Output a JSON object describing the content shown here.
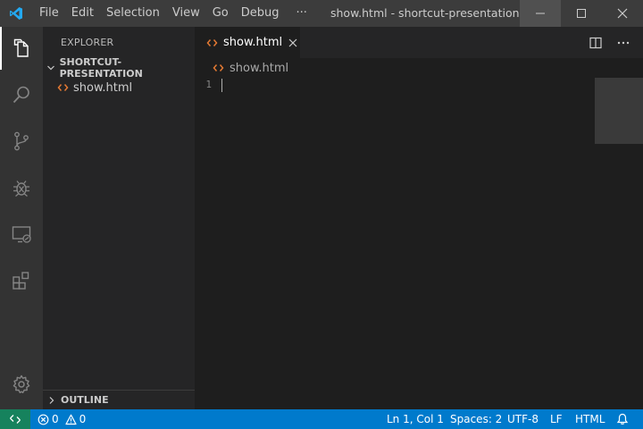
{
  "colors": {
    "accent": "#007acc",
    "remote": "#16825d",
    "logo": "#23a9f2",
    "html_icon": "#e37933",
    "titlebar": "#3c3c3c",
    "activitybar": "#333333",
    "sidebar": "#252526",
    "editor": "#1e1e1e"
  },
  "titlebar": {
    "logo_icon": "vscode-logo",
    "menu": [
      "File",
      "Edit",
      "Selection",
      "View",
      "Go",
      "Debug",
      "···"
    ],
    "title": "show.html - shortcut-presentation [Ad...",
    "buttons": [
      "minimize-icon",
      "maximize-icon",
      "close-icon"
    ]
  },
  "activitybar": {
    "items": [
      "explorer-icon",
      "search-icon",
      "source-control-icon",
      "debug-icon",
      "remote-explorer-icon",
      "extensions-icon"
    ],
    "active": "explorer-icon",
    "manage_icon": "gear-icon"
  },
  "sidebar": {
    "title": "EXPLORER",
    "folder": "SHORTCUT-PRESENTATION",
    "files": [
      {
        "name": "show.html",
        "icon": "html-file-icon"
      }
    ],
    "outline": "OUTLINE"
  },
  "editor": {
    "tab": {
      "label": "show.html",
      "icon": "html-file-icon"
    },
    "breadcrumb": "show.html",
    "line_numbers": [
      "1"
    ],
    "actions": [
      "split-editor-icon",
      "more-actions-icon"
    ]
  },
  "statusbar": {
    "errors": "0",
    "warnings": "0",
    "position": "Ln 1, Col 1",
    "indent": "Spaces: 2",
    "encoding": "UTF-8",
    "eol": "LF",
    "language": "HTML",
    "notification_icon": "bell-icon"
  }
}
